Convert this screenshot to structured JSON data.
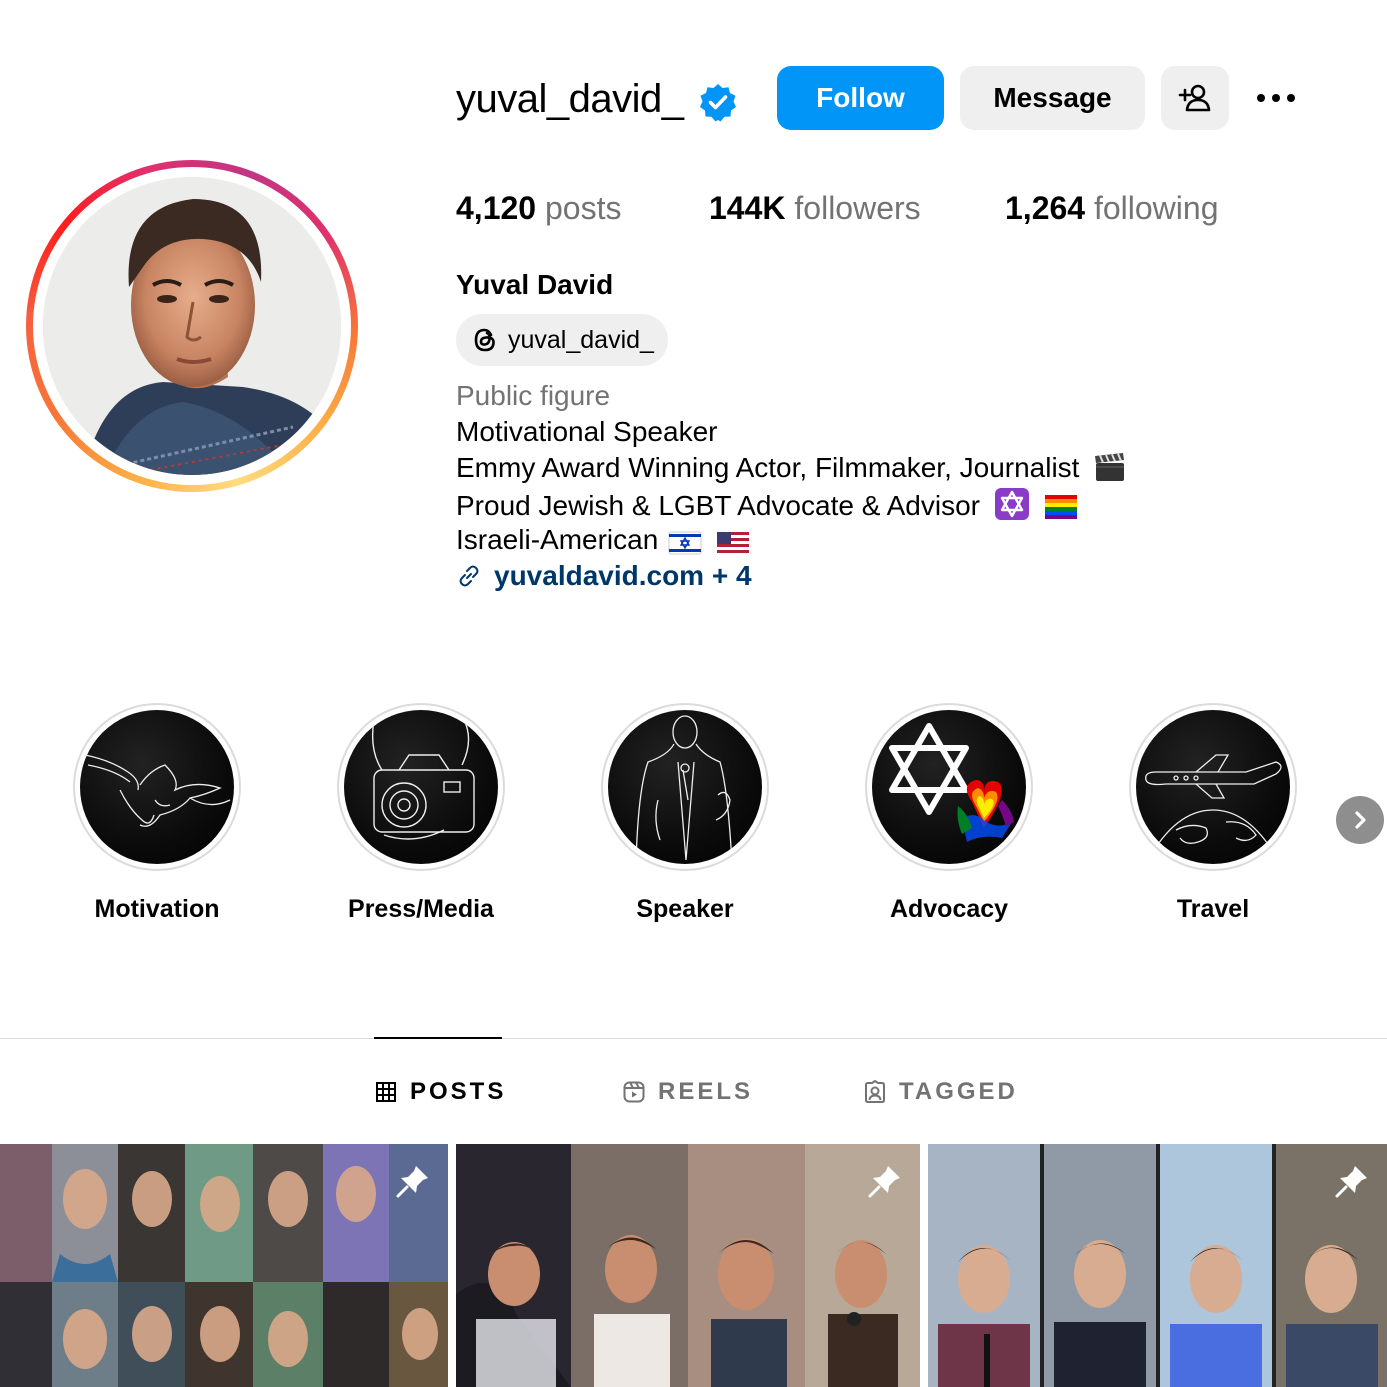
{
  "profile": {
    "username": "yuval_david_",
    "verified_icon": "verified-badge-icon",
    "full_name": "Yuval David",
    "threads_handle": "yuval_david_",
    "category": "Public figure",
    "bio_lines": [
      "Motivational Speaker",
      "Emmy Award Winning Actor, Filmmaker, Journalist",
      "Proud Jewish & LGBT Advocate & Advisor",
      "Israeli-American"
    ],
    "link_text": "yuvaldavid.com + 4"
  },
  "actions": {
    "follow": "Follow",
    "message": "Message"
  },
  "stats": {
    "posts_count": "4,120",
    "posts_label": "posts",
    "followers_count": "144K",
    "followers_label": "followers",
    "following_count": "1,264",
    "following_label": "following"
  },
  "highlights": [
    {
      "label": "Motivation",
      "icon": "dove-hands-icon"
    },
    {
      "label": "Press/Media",
      "icon": "camera-icon"
    },
    {
      "label": "Speaker",
      "icon": "speaker-microphone-icon"
    },
    {
      "label": "Advocacy",
      "icon": "star-of-david-icon"
    },
    {
      "label": "Travel",
      "icon": "airplane-globe-icon"
    }
  ],
  "tabs": {
    "posts": "POSTS",
    "reels": "REELS",
    "tagged": "TAGGED",
    "active": "posts"
  },
  "colors": {
    "follow_bg": "#0095f6",
    "link": "#00376b",
    "secondary_text": "#737373",
    "button_bg": "#efefef"
  }
}
